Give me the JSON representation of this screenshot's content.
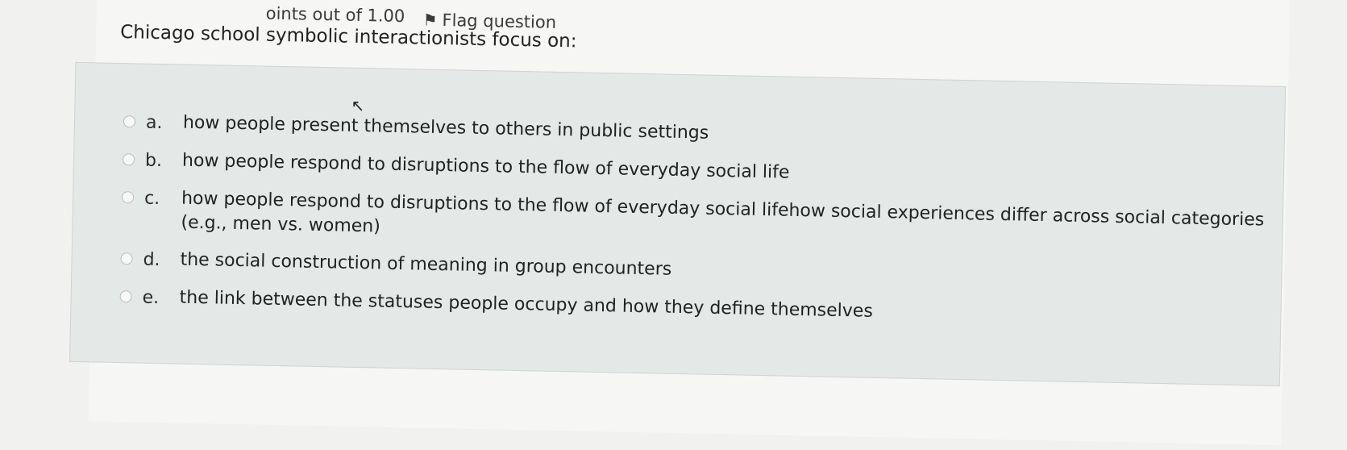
{
  "header": {
    "points_label": "oints out of 1.00",
    "flag_label": "Flag question"
  },
  "question": {
    "text": "Chicago school symbolic interactionists focus on:"
  },
  "options": [
    {
      "letter": "a.",
      "text": "how people present themselves to others in public settings"
    },
    {
      "letter": "b.",
      "text": "how people respond to disruptions to the flow of everyday social life"
    },
    {
      "letter": "c.",
      "text": "how people respond to disruptions to the flow of everyday social lifehow social experiences differ across social categories",
      "text_line2": "(e.g., men vs. women)"
    },
    {
      "letter": "d.",
      "text": "the social construction of meaning in group encounters"
    },
    {
      "letter": "e.",
      "text": "the link between the statuses people occupy and how they define themselves"
    }
  ],
  "icons": {
    "flag": "flag-icon",
    "cursor": "mouse-pointer-icon",
    "radio": "radio-button-icon"
  }
}
